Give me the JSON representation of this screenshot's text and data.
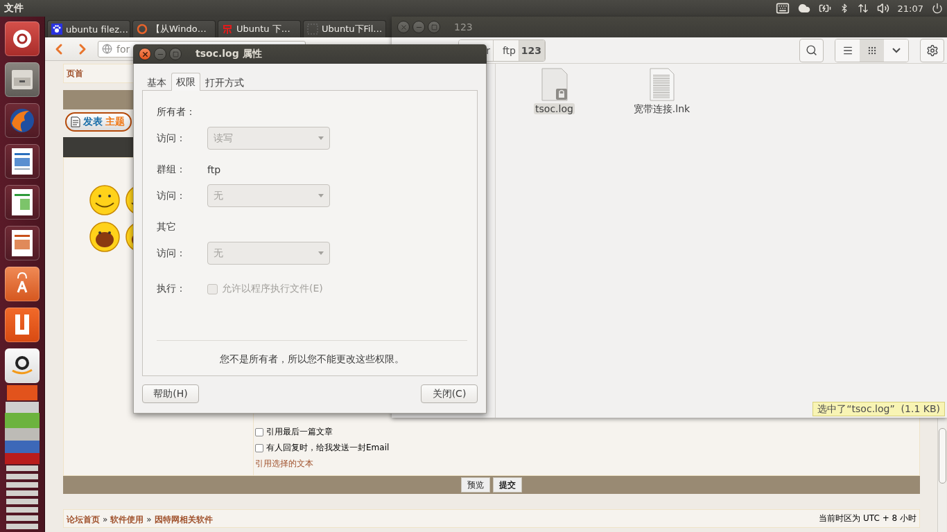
{
  "top_panel": {
    "app_menu": "文件",
    "clock": "21:07"
  },
  "browser": {
    "tabs": [
      {
        "title": "ubuntu filez…",
        "kind": "paw"
      },
      {
        "title": "【从Windo…",
        "kind": "ring"
      },
      {
        "title": "Ubuntu 下…",
        "kind": "glyph"
      },
      {
        "title": "Ubuntu下Fil…",
        "kind": "blank"
      }
    ],
    "url": "for",
    "forum": {
      "top_link": "页首",
      "new_topic": [
        "发表",
        "主题"
      ],
      "options": [
        {
          "label": "引用最后一篇文章",
          "checked": false
        },
        {
          "label": "有人回复时，给我发送一封Email",
          "checked": false
        }
      ],
      "quote_link": "引用选择的文本",
      "buttons": [
        {
          "label": "预览",
          "kind": "default"
        },
        {
          "label": "提交",
          "kind": "primary"
        }
      ],
      "breadcrumb": {
        "items": [
          "论坛首页",
          "软件使用",
          "因特网相关软件"
        ],
        "separator": "»"
      },
      "timezone": "当前时区为 UTC + 8 小时"
    }
  },
  "file_manager": {
    "title": "123",
    "path": [
      {
        "label": "r",
        "selected": false
      },
      {
        "label": "ftp",
        "selected": false
      },
      {
        "label": "123",
        "selected": true
      }
    ],
    "view_buttons": [
      {
        "kind": "list",
        "selected": false
      },
      {
        "kind": "grid",
        "selected": true
      },
      {
        "kind": "menu",
        "selected": false
      }
    ],
    "files": [
      {
        "name": "tsoc.log",
        "kind": "locked",
        "selected": true
      },
      {
        "name": "宽带连接.lnk",
        "kind": "text",
        "selected": false
      }
    ],
    "status": "选中了“tsoc.log”  (1.1 KB)"
  },
  "dialog": {
    "title": "tsoc.log 属性",
    "tabs": [
      {
        "label": "基本",
        "selected": false
      },
      {
        "label": "权限",
        "selected": true
      },
      {
        "label": "打开方式",
        "selected": false
      }
    ],
    "rows": [
      {
        "kind": "heading",
        "label": "所有者："
      },
      {
        "kind": "select",
        "label": "访问：",
        "value": "读写",
        "disabled": true
      },
      {
        "kind": "info",
        "label": "群组：",
        "value": "ftp"
      },
      {
        "kind": "select",
        "label": "访问：",
        "value": "无",
        "disabled": true
      },
      {
        "kind": "heading",
        "label": "其它"
      },
      {
        "kind": "select",
        "label": "访问：",
        "value": "无",
        "disabled": true
      },
      {
        "kind": "checkbox",
        "label": "执行：",
        "value": "允许以程序执行文件(E)",
        "checked": false,
        "disabled": true
      }
    ],
    "notice": "您不是所有者，所以您不能更改这些权限。",
    "buttons": [
      "帮助(H)",
      "关闭(C)"
    ]
  }
}
